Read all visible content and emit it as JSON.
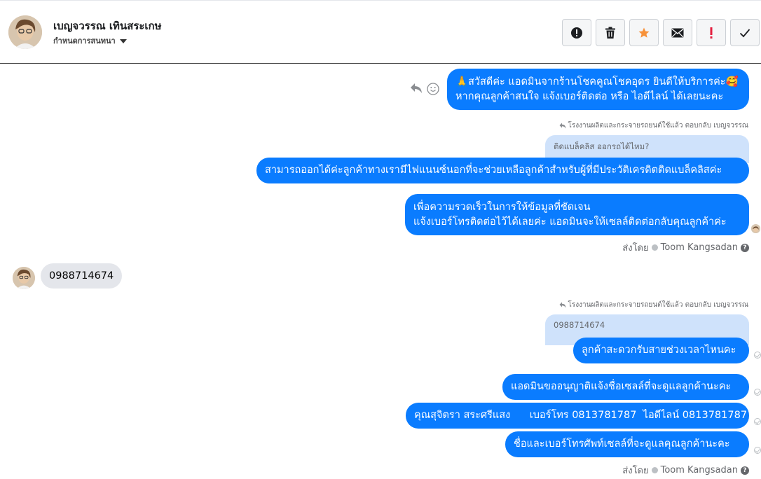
{
  "header": {
    "contact_name": "เบญจวรรณ เทินสระเกษ",
    "subtitle": "กำหนดการสนทนา",
    "actions": [
      "alert-icon",
      "trash-icon",
      "star-icon",
      "mail-icon",
      "important-icon",
      "check-icon"
    ]
  },
  "messages": {
    "m1": {
      "line1": "🙏สวัสดีค่ะ แอดมินจากร้านโชคคูณโชคอุดร ยินดีให้บริการค่ะ🥰",
      "line2": "หากคุณลูกค้าสนใจ แจ้งเบอร์ติดต่อ หรือ ไอดีไลน์ ได้เลยนะคะ"
    },
    "reply1": {
      "meta": "โรงงานผลิตและกระจายรถยนต์ใช้แล้ว ตอบกลับ เบญจวรรณ",
      "quote": "ติดแบล็คลิส ออกรถได้ไหม?"
    },
    "m2": "สามารถออกได้ค่ะลูกค้าทางเรามีไฟแนนซ์นอกที่จะช่วยเหลือลูกค้าสำหรับผู้ที่มีประวัติเครดิตติดแบล็คลิสค่ะ",
    "m3": {
      "line1": "เพื่อความรวดเร็วในการให้ข้อมูลที่ชัดเจน",
      "line2": "แจ้งเบอร์โทรติดต่อไว้ได้เลยค่ะ แอดมินจะให้เซลล์ติดต่อกลับคุณลูกค้าค่ะ"
    },
    "sent_by_1": {
      "prefix": "ส่งโดย",
      "name": "Toom Kangsadan"
    },
    "incoming": "0988714674",
    "reply2": {
      "meta": "โรงงานผลิตและกระจายรถยนต์ใช้แล้ว ตอบกลับ เบญจวรรณ",
      "quote": "0988714674"
    },
    "m4": "ลูกค้าสะดวกรับสายช่วงเวลาไหนคะ",
    "m5": "แอดมินขออนุญาติแจ้งชื่อเซลล์ที่จะดูแลลูกค้านะคะ",
    "m6": "คุณสุจิตรา สระศรีแสง      เบอร์โทร 0813781787  ไอดีไลน์ 0813781787",
    "m7": "ชื่อและเบอร์โทรศัพท์เซลล์ที่จะดูแลคุณลูกค้านะคะ",
    "sent_by_2": {
      "prefix": "ส่งโดย",
      "name": "Toom Kangsadan"
    }
  },
  "colors": {
    "outgoing": "#0a7cff",
    "incoming": "#e4e6eb",
    "quote": "#cfe2fb",
    "star": "#f7923a",
    "important": "#e41e3f"
  }
}
